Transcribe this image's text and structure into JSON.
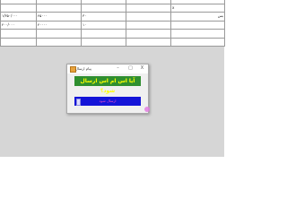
{
  "grid": {
    "rows": [
      {
        "c1": "",
        "c2": "",
        "c3": "",
        "c4": "",
        "c5": ""
      },
      {
        "c1": "۱/۳۵۰/۰۰۰",
        "c2": "۴۵۰۰۰",
        "c3": "۳۰",
        "c4": "",
        "c5": "بس"
      },
      {
        "c1": "۴۰۰/۰۰۰",
        "c2": "۴۰۰۰۰",
        "c3": "۱۰",
        "c4": "",
        "c5": ""
      },
      {
        "c1": "",
        "c2": "",
        "c3": "",
        "c4": "",
        "c5": ""
      },
      {
        "c1": "",
        "c2": "",
        "c3": "",
        "c4": "",
        "c5": ""
      },
      {
        "c1": "",
        "c2": "",
        "c3": "",
        "c4": "",
        "c5": ""
      }
    ],
    "header_mark": "x"
  },
  "dialog": {
    "title": "پیام ارسال",
    "minimize": "–",
    "maximize": "□",
    "close": "X",
    "question": "آیا اس ام اس ارسال شود؟",
    "reply_text": "ارسال شود"
  },
  "colors": {
    "question_bg": "#2f8f2f",
    "question_text": "#ffff00",
    "reply_bg": "#1414d8"
  }
}
